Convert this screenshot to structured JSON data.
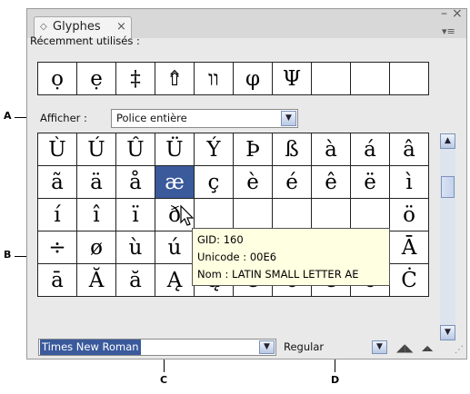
{
  "callouts": {
    "a": "A",
    "b": "B",
    "c": "C",
    "d": "D"
  },
  "panel": {
    "tab_title": "Glyphes",
    "tab_close_glyph": "×",
    "window_minimize_glyph": "–",
    "window_close_glyph": "×",
    "menu_glyph": "▾≡",
    "diamond_glyph": "◇"
  },
  "recent": {
    "label": "Récemment utilisés :",
    "glyphs": [
      "ọ",
      "ẹ",
      "‡",
      "⇮",
      "וו",
      "φ",
      "Ψ",
      "",
      "",
      ""
    ]
  },
  "show": {
    "label": "Afficher :",
    "value": "Police entière"
  },
  "glyph_grid": [
    [
      "Ù",
      "Ú",
      "Û",
      "Ü",
      "Ý",
      "Þ",
      "ß",
      "à",
      "á",
      "â"
    ],
    [
      "ã",
      "ä",
      "å",
      "æ",
      "ç",
      "è",
      "é",
      "ê",
      "ë",
      "ì"
    ],
    [
      "í",
      "î",
      "ï",
      "ð",
      "",
      "",
      "",
      "",
      "",
      "ö"
    ],
    [
      "÷",
      "ø",
      "ù",
      "ú",
      "",
      "",
      "ý",
      "þ",
      "ÿ",
      "Ā"
    ],
    [
      "ā",
      "Ă",
      "ă",
      "Ą",
      "ą",
      "Ć",
      "ć",
      "Ĉ",
      "ĉ",
      "Ċ"
    ]
  ],
  "selected_glyph": "æ",
  "tooltip": {
    "gid": "GID: 160",
    "unicode": "Unicode : 00E6",
    "name": "Nom :  LATIN SMALL LETTER AE"
  },
  "font": {
    "family": "Times New Roman",
    "style": "Regular"
  },
  "icons": {
    "dropdown": "▼",
    "scroll_up": "▲",
    "scroll_down": "▼",
    "zoom_out": "◢◣",
    "zoom_in": "◢◣",
    "grip": "⋰"
  },
  "colors": {
    "selection": "#3a5a9c",
    "tooltip_bg": "#ffffe1",
    "panel_bg": "#e9e9e9"
  }
}
